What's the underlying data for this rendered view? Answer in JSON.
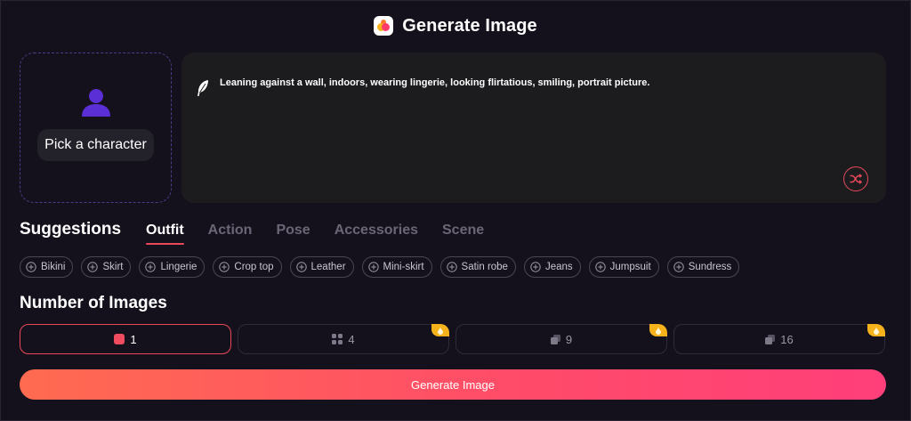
{
  "header": {
    "title": "Generate Image",
    "logo_icon": "app-logo-icon"
  },
  "character": {
    "pick_label": "Pick a character",
    "icon": "person-icon",
    "accent": "#5b2fd6"
  },
  "prompt": {
    "text": "Leaning against a wall, indoors, wearing lingerie, looking flirtatious, smiling, portrait picture.",
    "icon": "feather-icon",
    "shuffle_icon": "shuffle-icon"
  },
  "suggestions": {
    "title": "Suggestions",
    "tabs": [
      {
        "label": "Outfit",
        "active": true
      },
      {
        "label": "Action",
        "active": false
      },
      {
        "label": "Pose",
        "active": false
      },
      {
        "label": "Accessories",
        "active": false
      },
      {
        "label": "Scene",
        "active": false
      }
    ],
    "chips": [
      "Bikini",
      "Skirt",
      "Lingerie",
      "Crop top",
      "Leather",
      "Mini-skirt",
      "Satin robe",
      "Jeans",
      "Jumpsuit",
      "Sundress"
    ]
  },
  "images": {
    "title": "Number of Images",
    "options": [
      {
        "label": "1",
        "selected": true,
        "premium": false
      },
      {
        "label": "4",
        "selected": false,
        "premium": true
      },
      {
        "label": "9",
        "selected": false,
        "premium": true
      },
      {
        "label": "16",
        "selected": false,
        "premium": true
      }
    ]
  },
  "generate": {
    "label": "Generate Image"
  },
  "colors": {
    "accent": "#e8495a",
    "background": "#15111c",
    "premium_badge": "#f5b21b"
  }
}
